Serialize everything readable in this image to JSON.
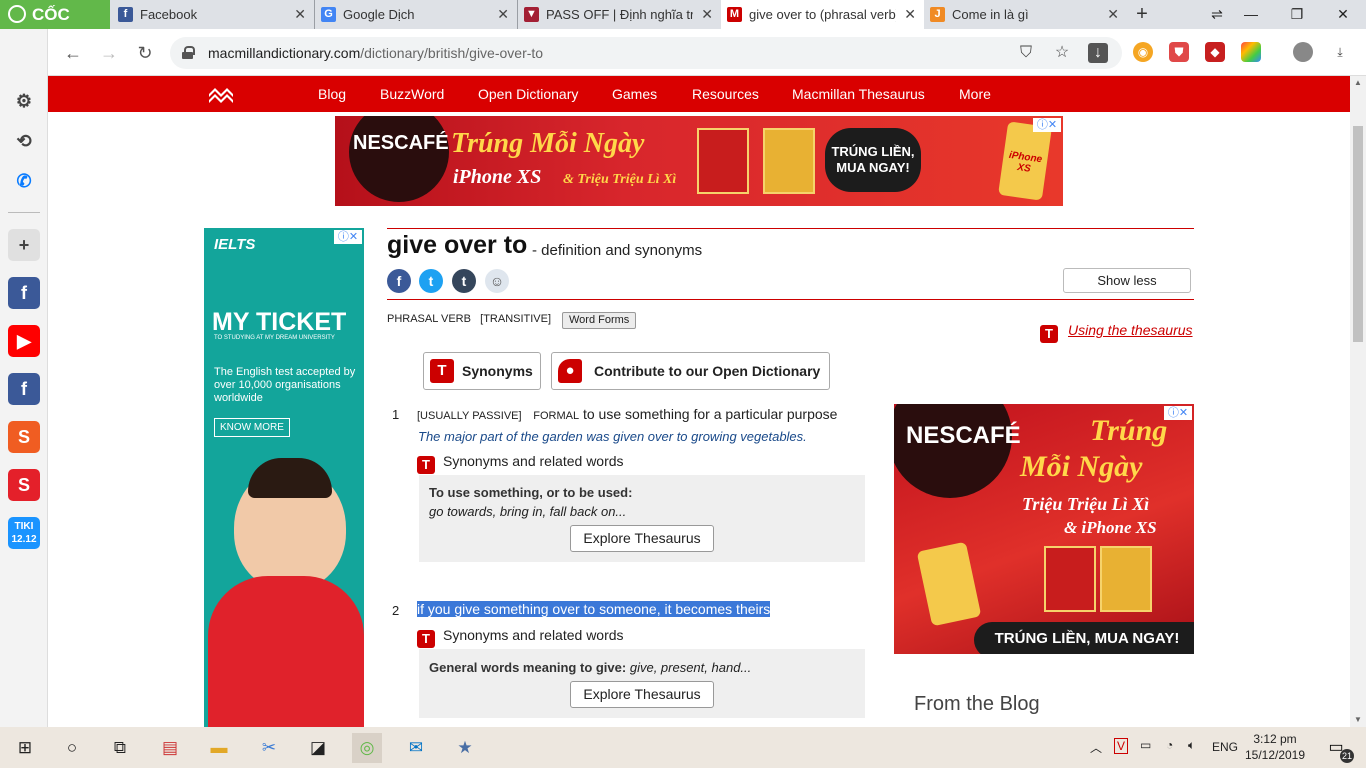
{
  "browser": {
    "brand": "CỐC CỐC",
    "tabs": [
      {
        "title": "Facebook",
        "active": false
      },
      {
        "title": "Google Dịch",
        "active": false
      },
      {
        "title": "PASS OFF | Định nghĩa trong",
        "active": false
      },
      {
        "title": "give over to (phrasal verb) d",
        "active": true
      },
      {
        "title": "Come in là gì",
        "active": false
      }
    ],
    "url_domain": "macmillandictionary.com",
    "url_path": "/dictionary/british/give-over-to"
  },
  "site": {
    "nav": [
      "Blog",
      "BuzzWord",
      "Open Dictionary",
      "Games",
      "Resources",
      "Macmillan Thesaurus",
      "More"
    ]
  },
  "ads": {
    "top": {
      "brand": "NESCAFÉ",
      "headline": "Trúng Mỗi Ngày",
      "subline_1": "iPhone XS",
      "subline_2": "& Triệu Triệu Lì Xì",
      "cta": "TRÚNG LIỀN, MUA NGAY!",
      "prize": "iPhone XS"
    },
    "left": {
      "brand": "IELTS",
      "headline": "MY TICKET",
      "tagline": "TO STUDYING AT MY DREAM UNIVERSITY",
      "body": "The English test accepted by over 10,000 organisations worldwide",
      "cta": "KNOW MORE"
    },
    "right": {
      "brand": "NESCAFÉ",
      "line_1": "Trúng",
      "line_2": "Mỗi Ngày",
      "line_3": "Triệu Triệu Lì Xì",
      "line_4": "& iPhone XS",
      "cta": "TRÚNG LIỀN, MUA NGAY!"
    }
  },
  "entry": {
    "headword": "give over to",
    "subtitle": "- definition and synonyms",
    "show_less": "Show less",
    "pos": "PHRASAL VERB",
    "grammar": "[TRANSITIVE]",
    "word_forms": "Word Forms",
    "thesaurus_link": "Using the thesaurus",
    "synonyms_btn": "Synonyms",
    "contribute_btn": "Contribute to our Open Dictionary",
    "senses": [
      {
        "num": "1",
        "labels": "[USUALLY PASSIVE]",
        "register": "FORMAL",
        "def": "to use something for a particular purpose",
        "example": "The major part of the garden was given over to growing vegetables.",
        "syn_heading": "Synonyms and related words",
        "syn_box_title": "To use something, or to be used:",
        "syn_box_list": "go towards, bring in, fall back on...",
        "explore": "Explore Thesaurus"
      },
      {
        "num": "2",
        "def": "if you give something over to someone, it becomes theirs",
        "syn_heading": "Synonyms and related words",
        "syn_box_title": "General words meaning to give:",
        "syn_box_list": "give, present, hand...",
        "explore": "Explore Thesaurus"
      }
    ]
  },
  "blog_heading": "From the Blog",
  "taskbar": {
    "lang": "ENG",
    "time": "3:12 pm",
    "date": "15/12/2019",
    "notifications": "21"
  },
  "colors": {
    "brand_red": "#d90000",
    "coccoc_green": "#62b84a",
    "ielts_teal": "#13a59b"
  }
}
